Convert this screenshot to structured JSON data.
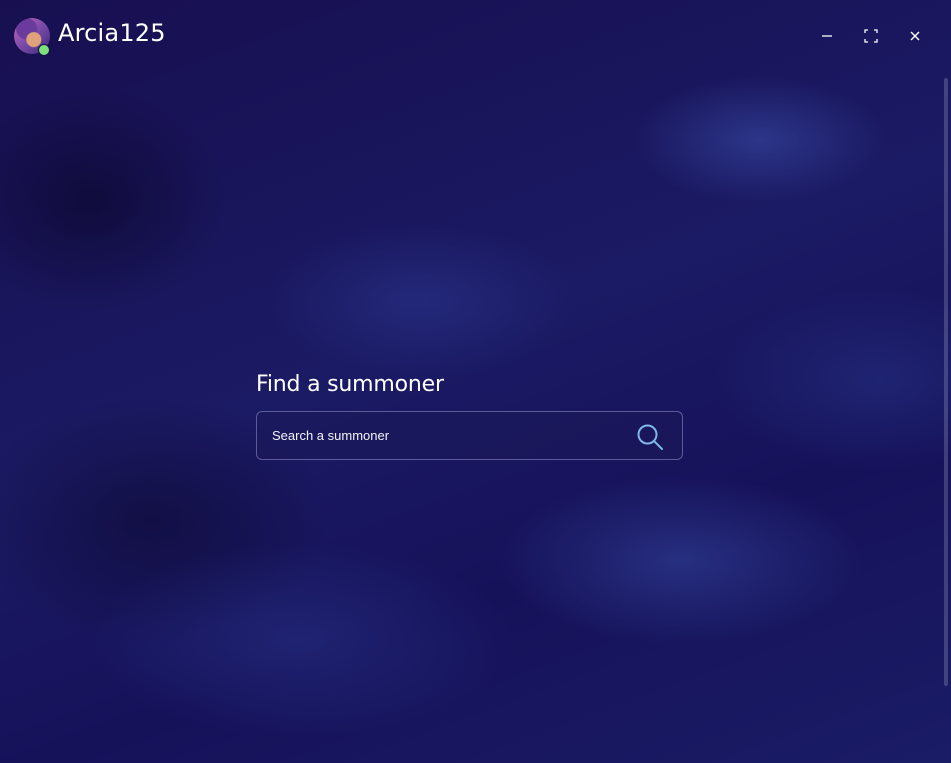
{
  "titlebar": {
    "username": "Arcia125",
    "status": "online",
    "status_color": "#7ee07a",
    "window_controls": [
      {
        "name": "minimize",
        "icon": "minimize-icon"
      },
      {
        "name": "maximize",
        "icon": "maximize-icon"
      },
      {
        "name": "close",
        "icon": "close-icon"
      }
    ]
  },
  "search": {
    "heading": "Find a summoner",
    "placeholder": "Search a summoner",
    "value": "",
    "icon": "search-icon",
    "icon_color": "#7fb8e8"
  },
  "theme": {
    "background": "#16125a",
    "text": "#ffffff",
    "accent": "#7fb8e8"
  }
}
